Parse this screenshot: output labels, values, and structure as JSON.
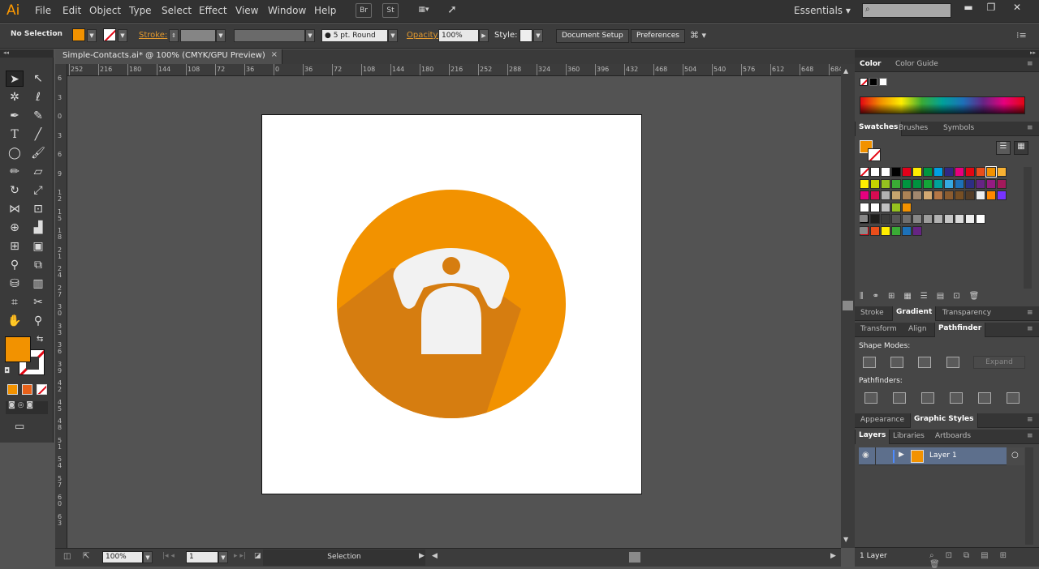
{
  "app": {
    "logo": "Ai"
  },
  "menu": [
    "File",
    "Edit",
    "Object",
    "Type",
    "Select",
    "Effect",
    "View",
    "Window",
    "Help"
  ],
  "menu_buttons": {
    "br": "Br",
    "st": "St"
  },
  "workspace": {
    "label": "Essentials ▾"
  },
  "window_buttons": {
    "minimize": "▬",
    "restore": "❐",
    "close": "✕"
  },
  "control": {
    "selection_label": "No Selection",
    "fill_color": "#f29200",
    "stroke_label": "Stroke:",
    "brush_label": "5 pt. Round",
    "opacity_label": "Opacity:",
    "opacity_value": "100%",
    "style_label": "Style:",
    "document_setup": "Document Setup",
    "preferences": "Preferences"
  },
  "document_tab": {
    "title": "Simple-Contacts.ai* @ 100% (CMYK/GPU Preview)",
    "close": "×"
  },
  "ruler": {
    "h_ticks": [
      "252",
      "216",
      "180",
      "144",
      "108",
      "72",
      "36",
      "0",
      "36",
      "72",
      "108",
      "144",
      "180",
      "216",
      "252",
      "288",
      "324",
      "360",
      "396",
      "432",
      "468",
      "504",
      "540",
      "576",
      "612",
      "648",
      "684",
      "72"
    ],
    "v_ticks": [
      "6",
      "3",
      "0",
      "3",
      "6",
      "9",
      "1 2",
      "1 5",
      "1 8",
      "2 1",
      "2 4",
      "2 7",
      "3 0",
      "3 3",
      "3 6",
      "3 9",
      "4 2",
      "4 5",
      "4 8",
      "5 1",
      "5 4",
      "5 7",
      "6 0",
      "6 3"
    ]
  },
  "artwork": {
    "circle_color": "#f29200",
    "shadow_color": "#d67d10",
    "figure_color": "#f2f2f2",
    "head_color": "#d67d10"
  },
  "statusbar": {
    "zoom": "100%",
    "artboard": "1",
    "mode": "Selection"
  },
  "panels": {
    "color": {
      "tabs": [
        "Color",
        "Color Guide"
      ]
    },
    "swatches": {
      "tabs": [
        "Swatches",
        "Brushes",
        "Symbols"
      ]
    },
    "stroke_group": {
      "tabs": [
        "Stroke",
        "Gradient",
        "Transparency"
      ]
    },
    "transform_group": {
      "tabs": [
        "Transform",
        "Align",
        "Pathfinder"
      ]
    },
    "pathfinder": {
      "shape_modes_label": "Shape Modes:",
      "pathfinders_label": "Pathfinders:",
      "expand_label": "Expand"
    },
    "appearance_group": {
      "tabs": [
        "Appearance",
        "Graphic Styles"
      ]
    },
    "layers_group": {
      "tabs": [
        "Layers",
        "Libraries",
        "Artboards"
      ]
    },
    "layers": {
      "items": [
        "Layer 1"
      ],
      "count": "1 Layer"
    }
  },
  "swatch_rows": [
    [
      "none",
      "#ffffff",
      "#ffffff",
      "#000000",
      "#e2001a",
      "#ffed00",
      "#00963f",
      "#009fe3",
      "#312783",
      "#e6007e",
      "#e30613",
      "#e94e1b",
      "#f29200",
      "#f9b233"
    ],
    [
      "#ffed00",
      "#c5d300",
      "#95c11f",
      "#3aaa35",
      "#00963f",
      "#00923f",
      "#13a538",
      "#00a19a",
      "#36a9e1",
      "#1d71b8",
      "#2d2e83",
      "#662483",
      "#951b81",
      "#a3195b"
    ],
    [
      "#e6007e",
      "#d60b52",
      "#b2b2b2",
      "#c6a46d",
      "#ad8355",
      "#a1876e",
      "#d3a871",
      "#b47646",
      "#8b5c30",
      "#774f24",
      "#543d27",
      "#ededed",
      "#ff8800",
      "#7733ff"
    ],
    [
      "#ffffff",
      "#ffffff",
      "#c1c1c1",
      "#95c11f",
      "#f39200"
    ],
    [
      "#000000",
      "#1d1d1b",
      "#3c3c3b",
      "#575756",
      "#706f6f",
      "#878787",
      "#9d9d9c",
      "#b2b2b2",
      "#c6c6c6",
      "#dadada",
      "#ededed",
      "#ffffff"
    ],
    [
      "#e30613",
      "#e94e1b",
      "#ffed00",
      "#3aaa35",
      "#1d71b8",
      "#662483"
    ]
  ]
}
